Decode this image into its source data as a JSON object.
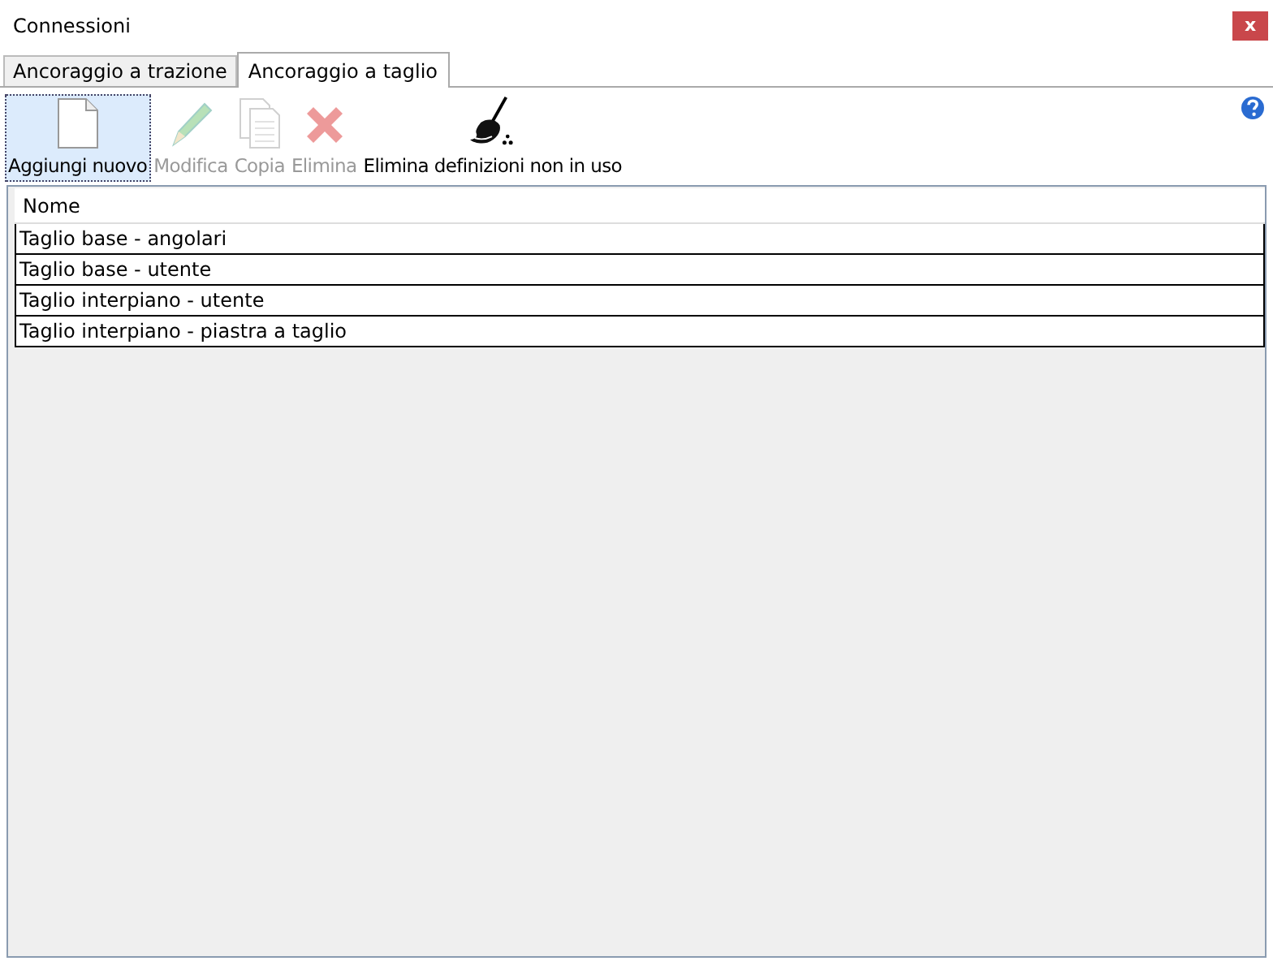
{
  "window": {
    "title": "Connessioni",
    "close": "x"
  },
  "tabs": [
    {
      "label": "Ancoraggio a trazione",
      "selected": false
    },
    {
      "label": "Ancoraggio a taglio",
      "selected": true
    }
  ],
  "toolbar": [
    {
      "label": "Aggiungi nuovo",
      "kind": "new",
      "disabled": false,
      "focused": true
    },
    {
      "label": "Modifica",
      "kind": "edit",
      "disabled": true,
      "focused": false
    },
    {
      "label": "Copia",
      "kind": "copy",
      "disabled": true,
      "focused": false
    },
    {
      "label": "Elimina",
      "kind": "delete",
      "disabled": true,
      "focused": false
    },
    {
      "label": "Elimina definizioni non in uso",
      "kind": "clean",
      "disabled": false,
      "focused": false
    }
  ],
  "table": {
    "columns": [
      "Nome"
    ],
    "rows": [
      [
        "Taglio base - angolari"
      ],
      [
        "Taglio base - utente"
      ],
      [
        "Taglio interpiano - utente"
      ],
      [
        "Taglio interpiano - piastra a taglio"
      ]
    ]
  }
}
